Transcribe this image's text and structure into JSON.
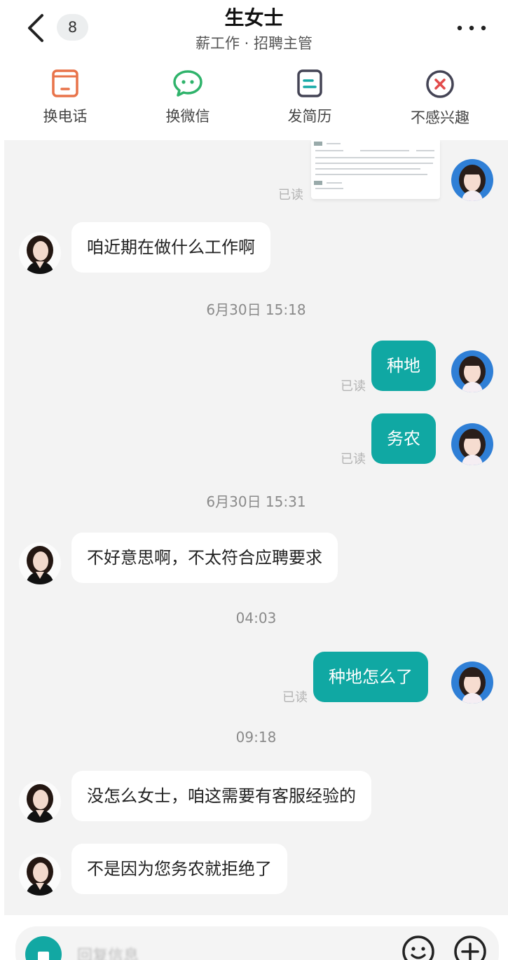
{
  "header": {
    "back_icon": "chevron-left-icon",
    "unread_count": "8",
    "title": "生女士",
    "subtitle": "薪工作 · 招聘主管",
    "more_icon": "more-dots-icon"
  },
  "actions": [
    {
      "label": "换电话",
      "icon": "phone-card-icon",
      "color": "#e8734a"
    },
    {
      "label": "换微信",
      "icon": "wechat-bubble-icon",
      "color": "#2fb36b"
    },
    {
      "label": "发简历",
      "icon": "resume-doc-icon",
      "color": "#15a9a5"
    },
    {
      "label": "不感兴趣",
      "icon": "not-interested-icon",
      "color": "#e24b4b"
    }
  ],
  "messages": [
    {
      "side": "right",
      "type": "resume-attachment",
      "read": "已读"
    },
    {
      "side": "left",
      "text": "咱近期在做什么工作啊"
    },
    {
      "time": "6月30日 15:18"
    },
    {
      "side": "right",
      "text": "种地",
      "read": "已读"
    },
    {
      "side": "right",
      "text": "务农",
      "read": "已读"
    },
    {
      "time": "6月30日 15:31"
    },
    {
      "side": "left",
      "text": "不好意思啊，不太符合应聘要求"
    },
    {
      "time": "04:03"
    },
    {
      "side": "right",
      "text": "种地怎么了",
      "read": "已读"
    },
    {
      "time": "09:18"
    },
    {
      "side": "left",
      "text": "没怎么女士，咱这需要有客服经验的"
    },
    {
      "side": "left",
      "text": "不是因为您务农就拒绝了"
    }
  ],
  "composer": {
    "placeholder": "回复信息",
    "emoji_icon": "emoji-icon",
    "plus_icon": "plus-icon"
  },
  "colors": {
    "accent": "#10a8a3",
    "chat_bg": "#f3f3f3"
  }
}
